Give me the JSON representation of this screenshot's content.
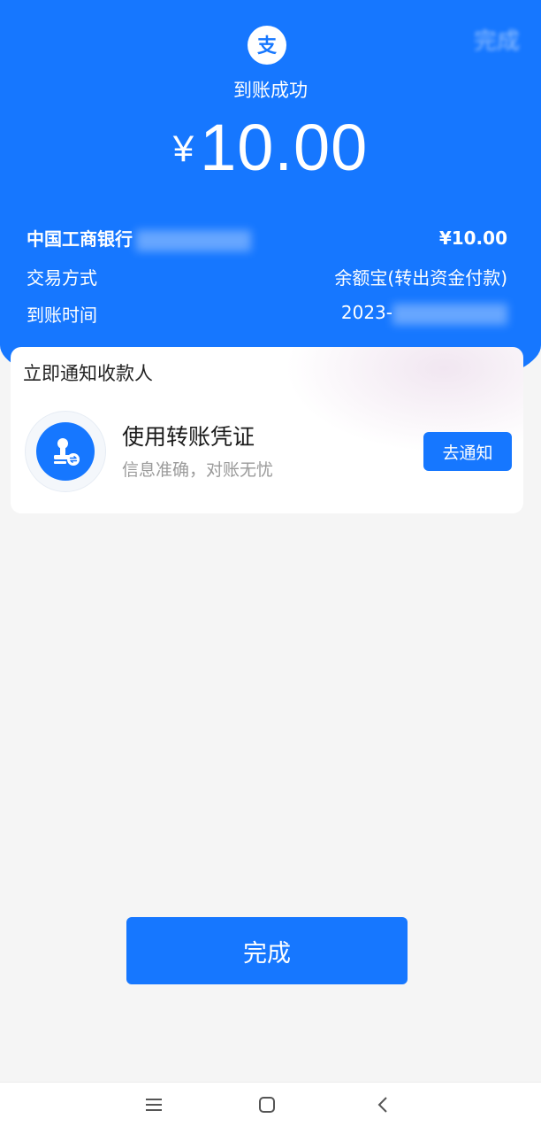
{
  "header": {
    "done_label": "完成",
    "status_text": "到账成功",
    "currency_symbol": "¥",
    "amount": "10.00"
  },
  "details": {
    "bank_name": "中国工商银行",
    "bank_amount": "¥10.00",
    "method_label": "交易方式",
    "method_value": "余额宝(转出资金付款)",
    "time_label": "到账时间",
    "time_value_prefix": "2023-"
  },
  "notify_card": {
    "title": "立即通知收款人",
    "voucher_title": "使用转账凭证",
    "voucher_subtitle": "信息准确，对账无忧",
    "button_label": "去通知"
  },
  "footer": {
    "done_button_label": "完成"
  },
  "icons": {
    "logo": "alipay-logo-icon",
    "stamp": "stamp-icon",
    "nav_menu": "menu-icon",
    "nav_home": "square-home-icon",
    "nav_back": "back-chevron-icon"
  },
  "colors": {
    "brand_blue": "#1677ff",
    "background": "#f5f5f5"
  }
}
